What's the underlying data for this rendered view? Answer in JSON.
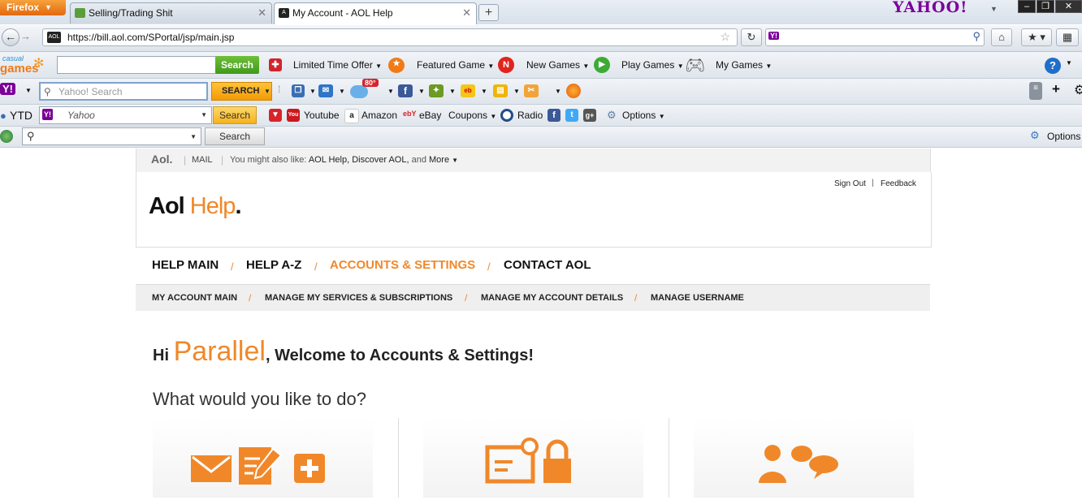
{
  "browser": {
    "menu_button": "Firefox",
    "tabs": [
      {
        "label": "Selling/Trading Shit"
      },
      {
        "label": "My Account - AOL Help"
      }
    ],
    "new_tab": "+",
    "yahoo_logo": "YAHOO!",
    "url": "https://bill.aol.com/SPortal/jsp/main.jsp"
  },
  "casual_games_bar": {
    "logo_small": "casual",
    "logo_big": "games",
    "search_button": "Search",
    "items": [
      "Limited Time Offer",
      "Featured Game",
      "New Games",
      "Play Games",
      "My Games"
    ]
  },
  "yahoo_bar": {
    "search_placeholder": "Yahoo! Search",
    "search_button": "SEARCH",
    "weather": "80°"
  },
  "ytd_bar": {
    "label": "YTD",
    "search_placeholder": "Yahoo",
    "search_button": "Search",
    "items": [
      "Youtube",
      "Amazon",
      "eBay",
      "Coupons",
      "Radio",
      "Options"
    ]
  },
  "search_bar": {
    "search_button": "Search",
    "options": "Options"
  },
  "aol": {
    "top": {
      "brand": "Aol.",
      "mail": "MAIL",
      "also_like_prefix": "You might also like:",
      "also_like_links": "AOL Help, Discover AOL,",
      "and": "and",
      "more": "More"
    },
    "logo_aol": "Aol",
    "logo_help": "Help",
    "logo_dot": ".",
    "sign_out": "Sign Out",
    "feedback": "Feedback",
    "main_nav": [
      "HELP MAIN",
      "HELP A-Z",
      "ACCOUNTS & SETTINGS",
      "CONTACT AOL"
    ],
    "sub_nav": [
      "MY ACCOUNT MAIN",
      "MANAGE MY SERVICES & SUBSCRIPTIONS",
      "MANAGE MY ACCOUNT DETAILS",
      "MANAGE USERNAME"
    ],
    "greeting_hi": "Hi",
    "greeting_name": "Parallel",
    "greeting_rest": ", Welcome to Accounts & Settings!",
    "question": "What would you like to do?"
  },
  "colors": {
    "aol_orange": "#f0882a",
    "firefox_orange": "#e8770f",
    "yahoo_purple": "#7b0099"
  }
}
